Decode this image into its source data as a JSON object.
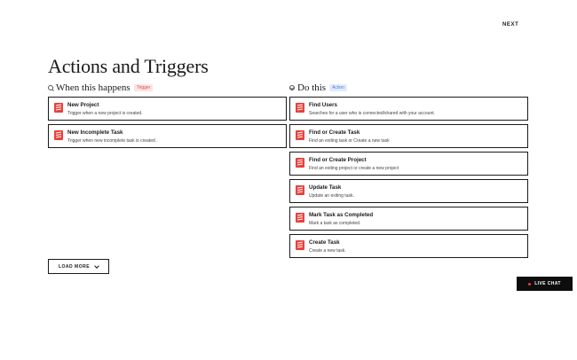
{
  "header": {
    "next_label": "NEXT",
    "title": "Actions and Triggers"
  },
  "triggers": {
    "heading": "When this happens",
    "badge": "Trigger",
    "icon": "magnifier-icon",
    "items": [
      {
        "title": "New Project",
        "description": "Trigger when a new project is created."
      },
      {
        "title": "New Incomplete Task",
        "description": "Trigger when new incomplete task is created ."
      }
    ]
  },
  "actions": {
    "heading": "Do this",
    "badge": "Action",
    "icon": "check-circle-icon",
    "items": [
      {
        "title": "Find Users",
        "description": "Searches for a user who is connected/shared with your account."
      },
      {
        "title": "Find or Create Task",
        "description": "Find an exiting task or Create a new task"
      },
      {
        "title": "Find or Create Project",
        "description": "Find an exiting project or create a new project"
      },
      {
        "title": "Update Task",
        "description": "Update an exiting task."
      },
      {
        "title": "Mark Task as Completed",
        "description": "Mark a task as completed."
      },
      {
        "title": "Create Task",
        "description": "Create a new task."
      }
    ]
  },
  "footer": {
    "load_more_label": "LOAD MORE",
    "live_chat_label": "LIVE CHAT"
  },
  "colors": {
    "brand_red": "#e8403b",
    "trigger_badge_bg": "#fde4e4",
    "trigger_badge_text": "#d9534f",
    "action_badge_bg": "#e3ecfd",
    "action_badge_text": "#4d7de0",
    "live_chat_bg": "#0d0d0d"
  }
}
